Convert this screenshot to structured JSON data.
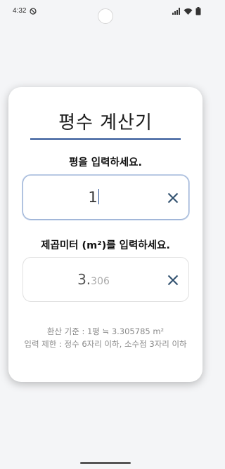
{
  "status_bar": {
    "time": "4:32",
    "dnd_icon": "do-not-disturb-icon",
    "signal_icon": "signal-icon",
    "wifi_icon": "wifi-icon",
    "battery_icon": "battery-icon"
  },
  "app": {
    "title": "평수 계산기",
    "accent_color": "#2f5597"
  },
  "pyeong": {
    "label": "평을 입력하세요.",
    "value": "1",
    "clear_icon": "close-icon"
  },
  "sqm": {
    "label": "제곱미터 (m²)를 입력하세요.",
    "value_main": "3.",
    "value_decimals": "306",
    "clear_icon": "close-icon"
  },
  "notes": {
    "conversion": "환산 기준 : 1평 ≒ 3.305785 m²",
    "limit": "입력 제한 : 정수 6자리 이하, 소수점 3자리 이하"
  }
}
